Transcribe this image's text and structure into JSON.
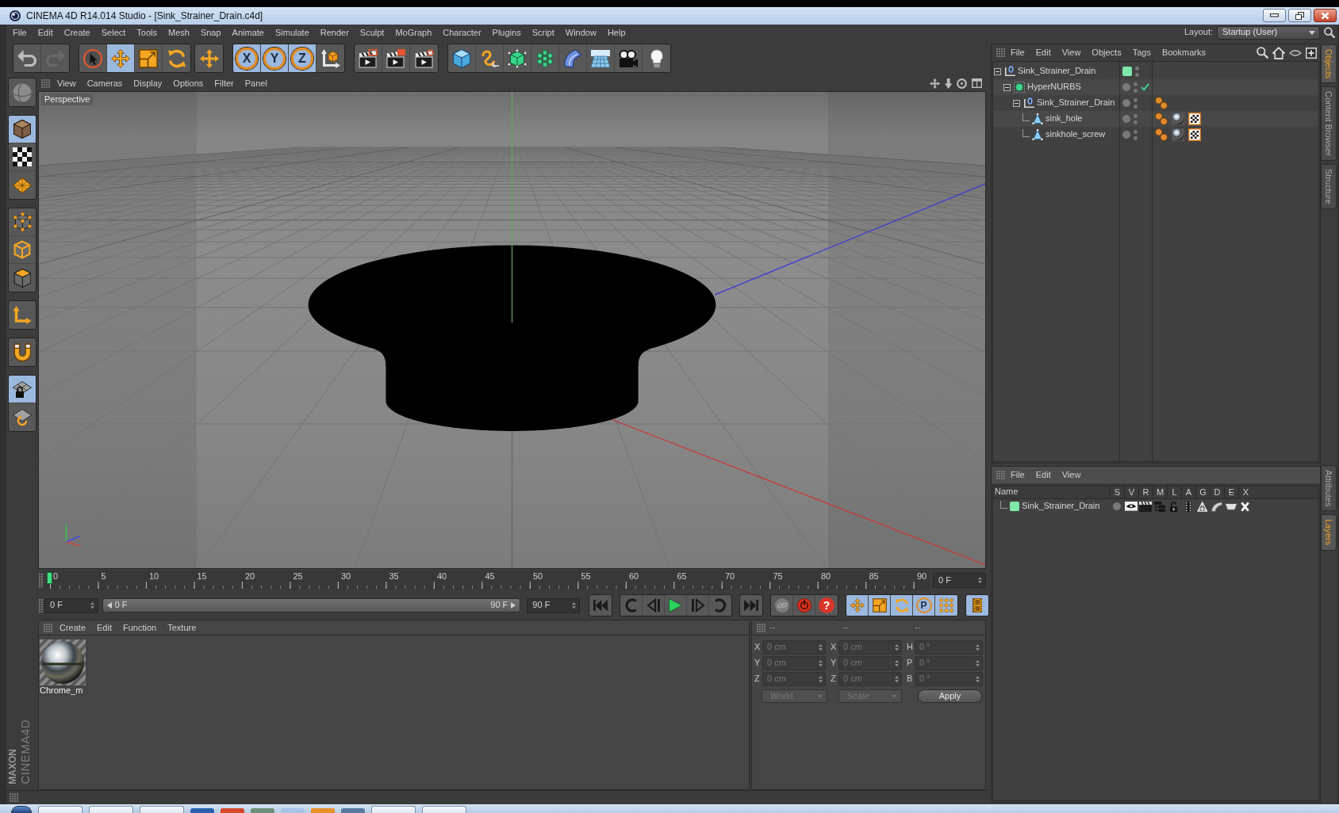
{
  "window": {
    "title": "CINEMA 4D R14.014 Studio - [Sink_Strainer_Drain.c4d]"
  },
  "menu_bar": [
    "File",
    "Edit",
    "Create",
    "Select",
    "Tools",
    "Mesh",
    "Snap",
    "Animate",
    "Simulate",
    "Render",
    "Sculpt",
    "MoGraph",
    "Character",
    "Plugins",
    "Script",
    "Window",
    "Help"
  ],
  "layout": {
    "label": "Layout:",
    "value": "Startup (User)"
  },
  "toolbar": [
    [
      {
        "kind": "undo",
        "disabled": false
      },
      {
        "kind": "redo",
        "disabled": true
      }
    ],
    [
      {
        "kind": "select",
        "selected": false
      },
      {
        "kind": "move",
        "selected": true
      },
      {
        "kind": "scale",
        "selected": false
      },
      {
        "kind": "rotate",
        "selected": false
      }
    ],
    [
      {
        "kind": "recent",
        "selected": false
      }
    ],
    [
      {
        "kind": "axis",
        "label": "X",
        "on": true
      },
      {
        "kind": "axis",
        "label": "Y",
        "on": true
      },
      {
        "kind": "axis",
        "label": "Z",
        "on": true
      },
      {
        "kind": "coords",
        "on": false
      }
    ],
    [
      {
        "kind": "renderview"
      },
      {
        "kind": "render"
      },
      {
        "kind": "rendersettings"
      }
    ],
    [
      {
        "kind": "cube"
      },
      {
        "kind": "spline"
      },
      {
        "kind": "nurbs"
      },
      {
        "kind": "cloner"
      },
      {
        "kind": "deformer"
      },
      {
        "kind": "floor"
      },
      {
        "kind": "camera"
      },
      {
        "kind": "light"
      }
    ]
  ],
  "mode_palette": [
    [
      {
        "kind": "editable",
        "on": false
      }
    ],
    [
      {
        "kind": "model",
        "on": true
      },
      {
        "kind": "texture",
        "on": false
      },
      {
        "kind": "workplane",
        "on": false
      }
    ],
    [
      {
        "kind": "points",
        "on": false
      },
      {
        "kind": "edges",
        "on": false
      },
      {
        "kind": "polygons",
        "on": false
      }
    ],
    [
      {
        "kind": "axis",
        "on": false
      }
    ],
    [
      {
        "kind": "snap",
        "on": false
      }
    ],
    [
      {
        "kind": "gridlock",
        "on": true
      },
      {
        "kind": "lockdrag",
        "on": false
      }
    ]
  ],
  "logo": {
    "brand": "MAXON",
    "product": "CINEMA4D"
  },
  "viewport": {
    "menu": [
      "View",
      "Cameras",
      "Display",
      "Options",
      "Filter",
      "Panel"
    ],
    "camera": "Perspective"
  },
  "timeline": {
    "labels": [
      "0",
      "5",
      "10",
      "15",
      "20",
      "25",
      "30",
      "35",
      "40",
      "45",
      "50",
      "55",
      "60",
      "65",
      "70",
      "75",
      "80",
      "85",
      "90"
    ],
    "level": 0,
    "current_frame": "0 F"
  },
  "playback": {
    "start": "0 F",
    "range": {
      "start": "0 F",
      "end": "90 F"
    },
    "end": "90 F",
    "buttons": [
      [
        {
          "kind": "first"
        }
      ],
      [
        {
          "kind": "prevkey"
        },
        {
          "kind": "prevframe"
        },
        {
          "kind": "play"
        },
        {
          "kind": "nextframe"
        },
        {
          "kind": "nextkey"
        }
      ],
      [
        {
          "kind": "last"
        }
      ],
      [
        {
          "kind": "autokey",
          "on": false
        },
        {
          "kind": "record",
          "on": false
        },
        {
          "kind": "keyhelp",
          "label": "?",
          "on": false
        }
      ],
      [
        {
          "kind": "keymove",
          "on": true
        },
        {
          "kind": "keyscale",
          "on": true
        },
        {
          "kind": "keyrotate",
          "on": true
        },
        {
          "kind": "keyparam",
          "label": "P",
          "on": true
        },
        {
          "kind": "keypoints",
          "on": true
        }
      ],
      [
        {
          "kind": "timeline",
          "on": true
        }
      ]
    ]
  },
  "materials": {
    "menu": [
      "Create",
      "Edit",
      "Function",
      "Texture"
    ],
    "items": [
      {
        "name": "Chrome_m"
      }
    ]
  },
  "coordinates": {
    "headers": [
      "--",
      "--",
      "--"
    ],
    "disabled": true,
    "rows": [
      {
        "labels": [
          "X",
          "X",
          "H"
        ],
        "values": [
          "0 cm",
          "0 cm",
          "0 °"
        ]
      },
      {
        "labels": [
          "Y",
          "Y",
          "P"
        ],
        "values": [
          "0 cm",
          "0 cm",
          "0 °"
        ]
      },
      {
        "labels": [
          "Z",
          "Z",
          "B"
        ],
        "values": [
          "0 cm",
          "0 cm",
          "0 °"
        ]
      }
    ],
    "dropdowns": [
      "World",
      "Scale"
    ],
    "apply": "Apply"
  },
  "object_manager": {
    "menu": [
      "File",
      "Edit",
      "View",
      "Objects",
      "Tags",
      "Bookmarks"
    ],
    "tree": [
      {
        "name": "Sink_Strainer_Drain",
        "kind": "null",
        "color": "#7de8a8",
        "expanded": true,
        "children": [
          {
            "name": "HyperNURBS",
            "kind": "nurbs",
            "enabled": true,
            "expanded": true,
            "children": [
              {
                "name": "Sink_Strainer_Drain",
                "kind": "null",
                "expanded": true,
                "tags": [
                  {
                    "kind": "phong"
                  }
                ],
                "children": [
                  {
                    "name": "sink_hole",
                    "kind": "polygon",
                    "tags": [
                      {
                        "kind": "phong"
                      },
                      {
                        "kind": "material"
                      },
                      {
                        "kind": "uvw"
                      }
                    ]
                  },
                  {
                    "name": "sinkhole_screw",
                    "kind": "polygon",
                    "tags": [
                      {
                        "kind": "phong"
                      },
                      {
                        "kind": "material"
                      },
                      {
                        "kind": "uvw"
                      }
                    ]
                  }
                ]
              }
            ]
          }
        ]
      }
    ]
  },
  "layer_manager": {
    "menu": [
      "File",
      "Edit",
      "View"
    ],
    "columns": [
      "Name",
      "S",
      "V",
      "R",
      "M",
      "L",
      "A",
      "G",
      "D",
      "E",
      "X"
    ],
    "layers": [
      {
        "name": "Sink_Strainer_Drain",
        "color": "#7de8a8",
        "solo": false,
        "flags": [
          {
            "kind": "view",
            "on": true
          },
          {
            "kind": "render",
            "on": true
          },
          {
            "kind": "manager",
            "on": true
          },
          {
            "kind": "locked",
            "on": false
          },
          {
            "kind": "animation",
            "on": true
          },
          {
            "kind": "generators",
            "on": true
          },
          {
            "kind": "deformers",
            "on": true
          },
          {
            "kind": "expressions",
            "on": true
          },
          {
            "kind": "xrefs",
            "on": true
          }
        ]
      }
    ]
  },
  "side_tabs": {
    "upper": [
      {
        "label": "Objects",
        "selected": true
      },
      {
        "label": "Content Browser",
        "selected": false
      },
      {
        "label": "Structure",
        "selected": false
      }
    ],
    "lower": [
      {
        "label": "Attributes",
        "selected": false
      },
      {
        "label": "Layers",
        "selected": true
      }
    ]
  }
}
